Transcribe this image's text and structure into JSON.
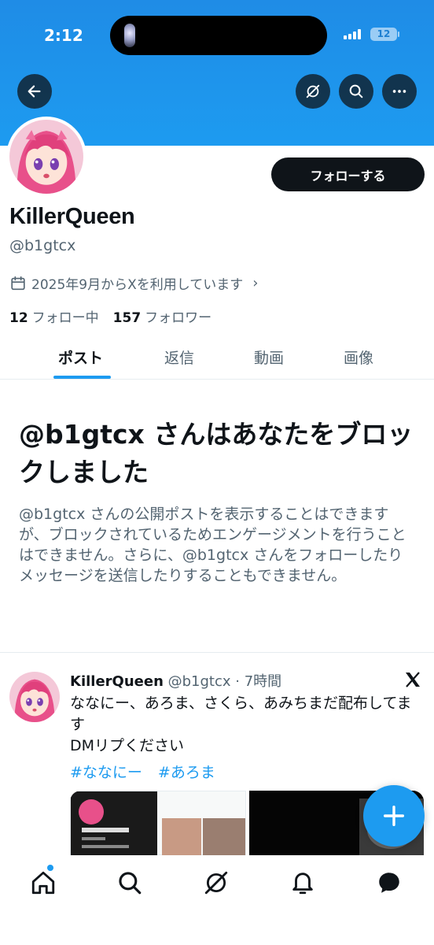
{
  "status_bar": {
    "time": "2:12",
    "battery": "12"
  },
  "profile": {
    "display_name": "KillerQueen",
    "handle": "@b1gtcx",
    "joined": "2025年9月からXを利用しています",
    "following_count": "12",
    "following_label": "フォロー中",
    "followers_count": "157",
    "followers_label": "フォロワー",
    "follow_button": "フォローする"
  },
  "tabs": [
    {
      "label": "ポスト",
      "active": true
    },
    {
      "label": "返信"
    },
    {
      "label": "動画"
    },
    {
      "label": "画像"
    }
  ],
  "blocked": {
    "title": "@b1gtcx さんはあなたをブロックしました",
    "body": "@b1gtcx さんの公開ポストを表示することはできますが、ブロックされているためエンゲージメントを行うことはできません。さらに、@b1gtcx さんをフォローしたりメッセージを送信したりすることもできません。"
  },
  "tweet": {
    "name": "KillerQueen",
    "meta": "@b1gtcx · 7時間",
    "text_line1": "ななにー、あろま、さくら、あみちまだ配布してます",
    "text_line2": "DMリプください",
    "hashtags": [
      "#ななにー",
      "#あろま"
    ]
  },
  "icons": {
    "back": "back-arrow-icon",
    "grok": "grok-icon",
    "search": "search-icon",
    "more": "more-icon",
    "calendar": "calendar-icon",
    "x_logo": "x-logo-icon",
    "compose": "plus-icon",
    "nav": [
      "home-icon",
      "search-icon",
      "grok-icon",
      "bell-icon",
      "messages-icon"
    ]
  },
  "colors": {
    "accent": "#1d9bf0",
    "text": "#0f1419",
    "secondary": "#536471"
  }
}
